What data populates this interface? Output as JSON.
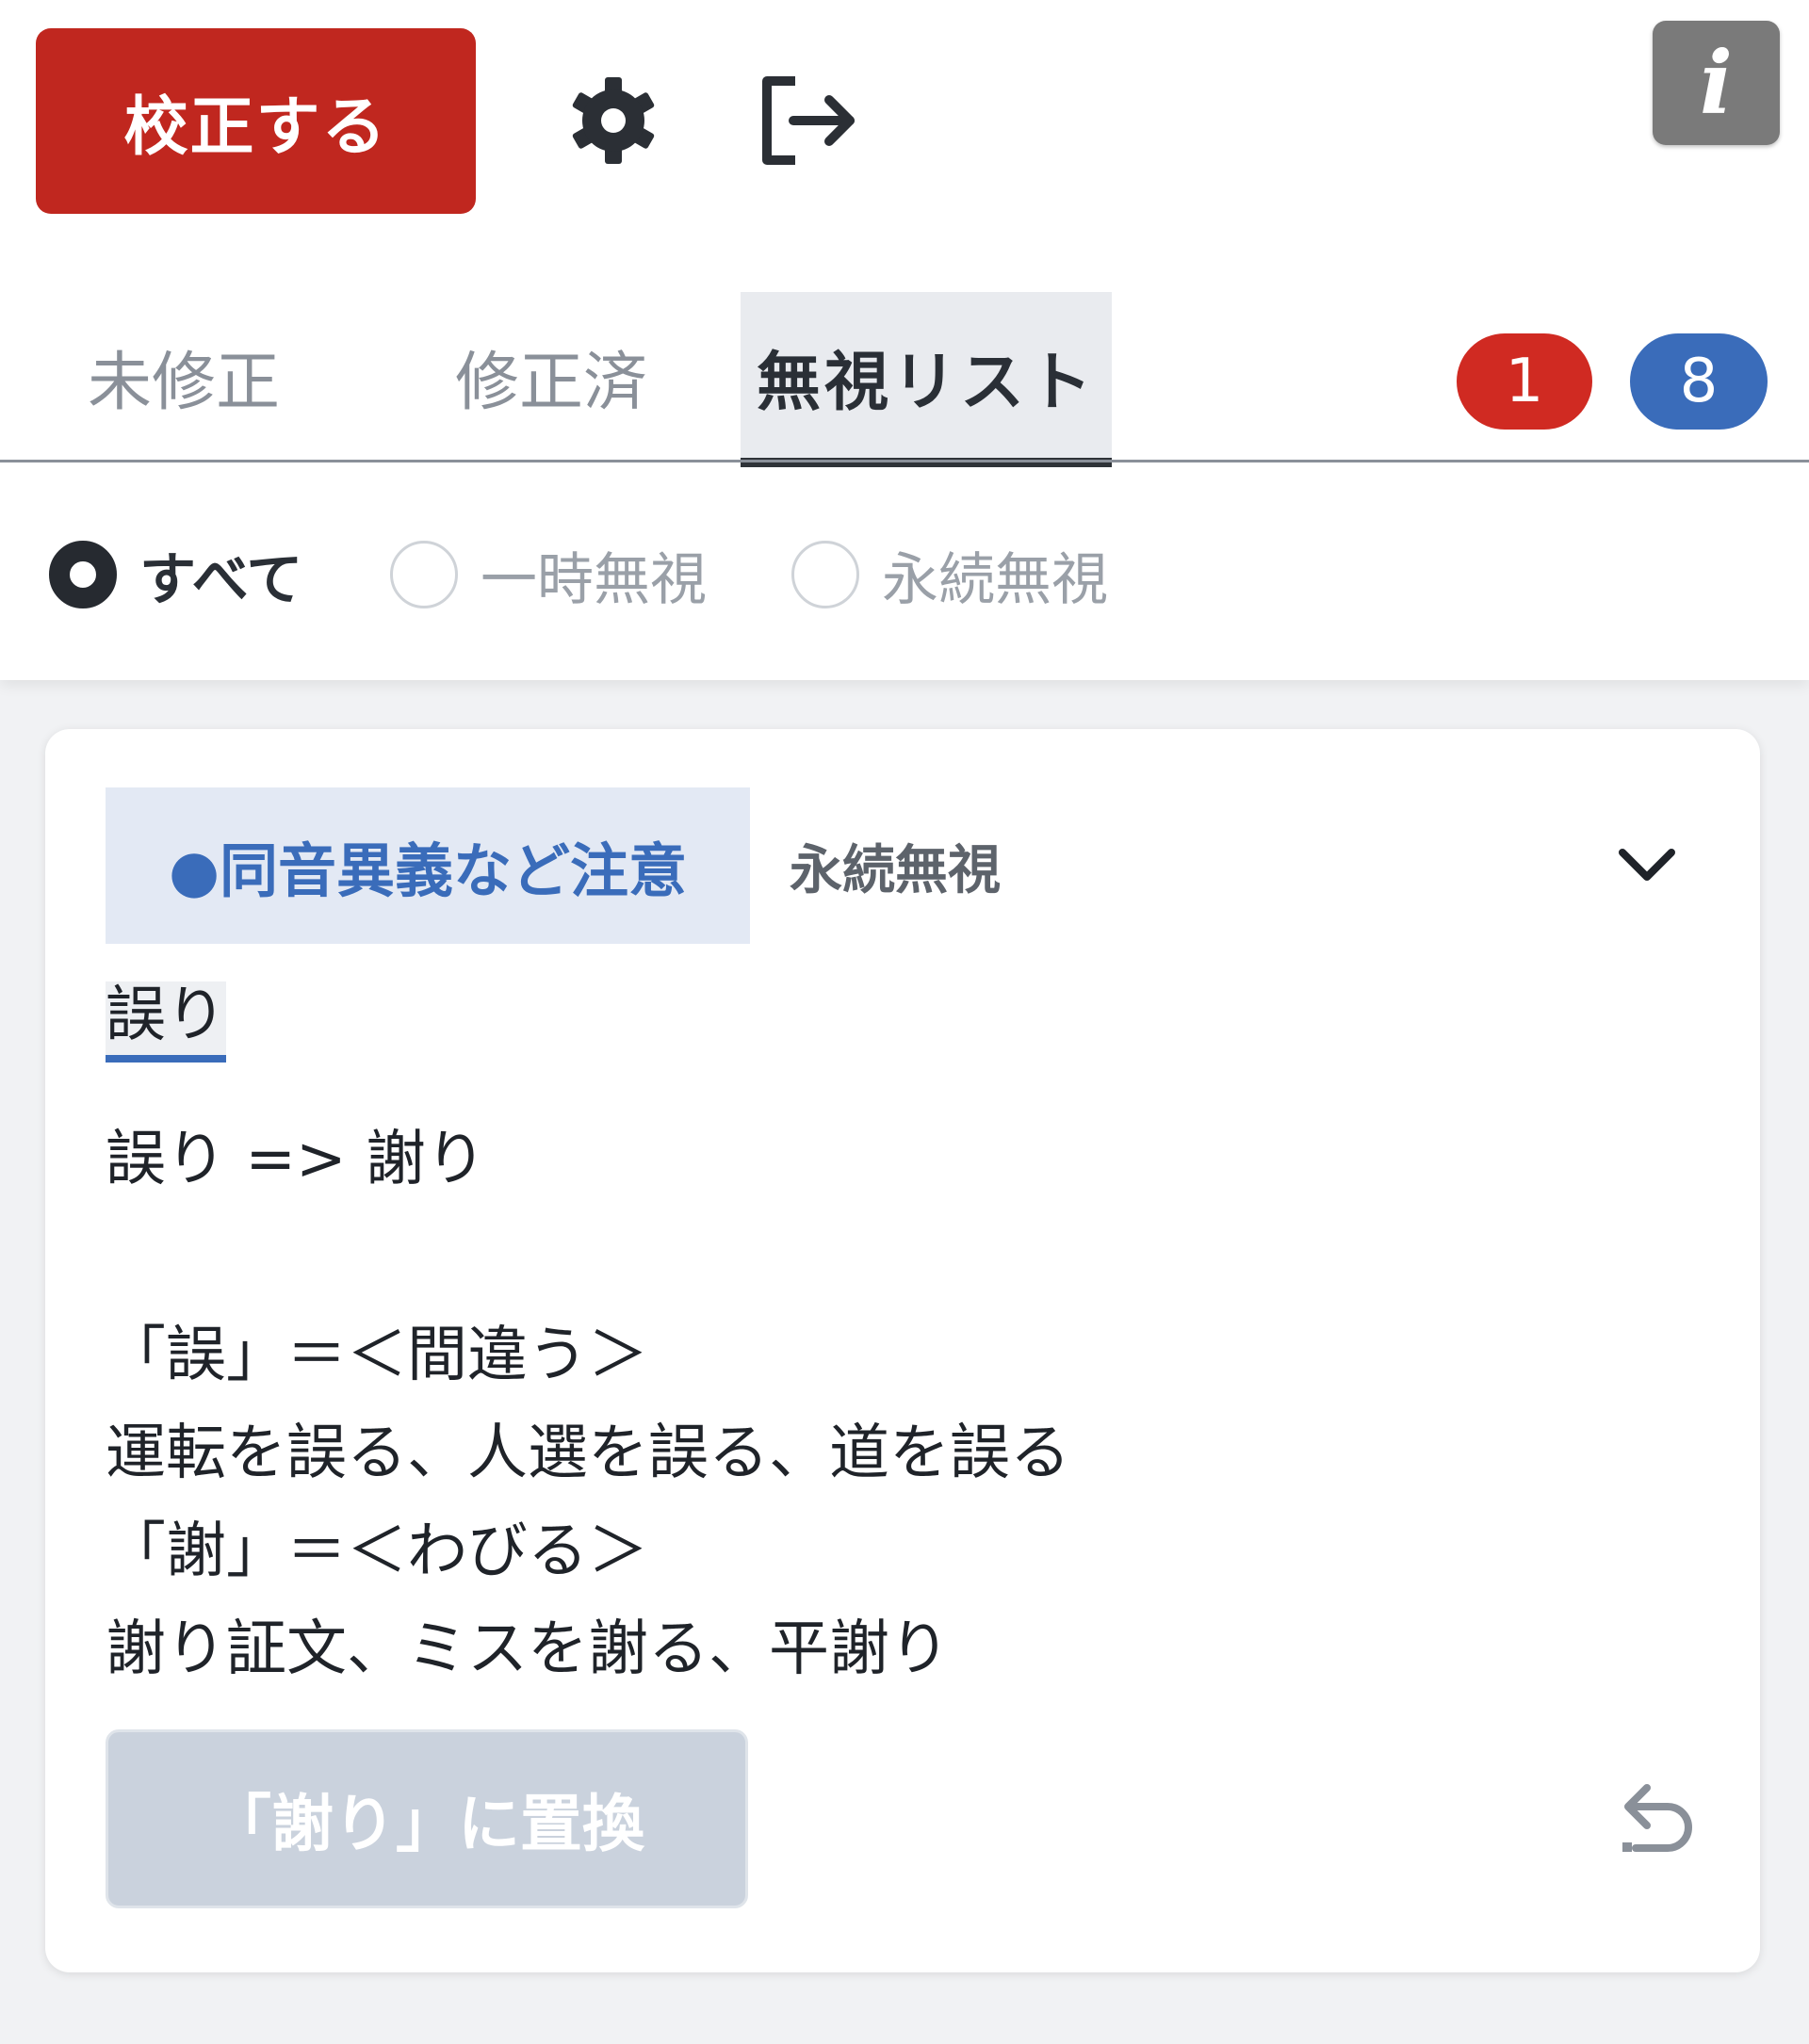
{
  "header": {
    "proofread_label": "校正する",
    "info_label": "i"
  },
  "tabs": [
    {
      "label": "未修正"
    },
    {
      "label": "修正済"
    },
    {
      "label": "無視リスト"
    }
  ],
  "badges": {
    "unfixed_count": "1",
    "ignored_count": "8"
  },
  "filter": {
    "options": [
      {
        "label": "すべて"
      },
      {
        "label": "一時無視"
      },
      {
        "label": "永続無視"
      }
    ]
  },
  "card": {
    "category": "●同音異義など注意",
    "status": "永続無視",
    "target_word": "誤り",
    "description": "誤り => 謝り\n\n「誤」＝＜間違う＞\n運転を誤る、人選を誤る、道を誤る\n「謝」＝＜わびる＞\n謝り証文、ミスを謝る、平謝り",
    "replace_label": "「謝り」に置換"
  },
  "colors": {
    "primary_red": "#c0271f",
    "badge_red": "#d02a22",
    "badge_blue": "#3a6cba",
    "info_gray": "#7a7a7a",
    "category_bg": "#e3e9f4",
    "disabled_button": "#cad2dd"
  },
  "icons": {
    "settings": "gear-icon",
    "logout": "logout-icon",
    "info": "info-icon",
    "expand": "chevron-down-icon",
    "undo": "undo-icon"
  }
}
